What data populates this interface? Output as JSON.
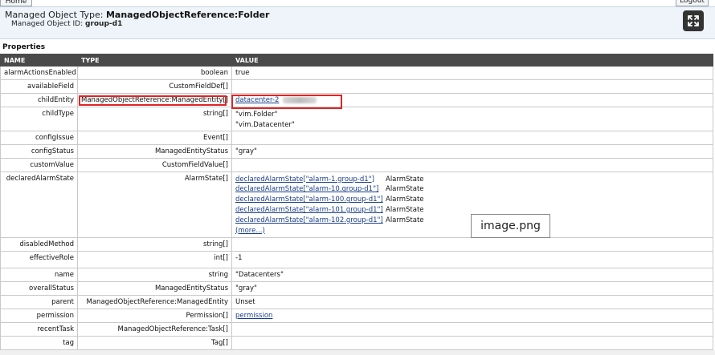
{
  "nav": {
    "home": "Home",
    "logout": "Logout"
  },
  "header": {
    "type_label": "Managed Object Type: ",
    "type_value": "ManagedObjectReference:Folder",
    "id_label": "Managed Object ID: ",
    "id_value": "group-d1"
  },
  "section_title": "Properties",
  "columns": {
    "name": "NAME",
    "type": "TYPE",
    "value": "VALUE"
  },
  "rows": [
    {
      "name": "alarmActionsEnabled",
      "type": "boolean",
      "value": "true"
    },
    {
      "name": "availableField",
      "type": "CustomFieldDef[]",
      "value": ""
    },
    {
      "name": "childEntity",
      "type": "ManagedObjectReference:ManagedEntity[]",
      "value_link": "datacenter-2"
    },
    {
      "name": "childType",
      "type": "string[]",
      "values": [
        "\"vim.Folder\"",
        "\"vim.Datacenter\""
      ]
    },
    {
      "name": "configIssue",
      "type": "Event[]",
      "value": ""
    },
    {
      "name": "configStatus",
      "type": "ManagedEntityStatus",
      "value": "\"gray\""
    },
    {
      "name": "customValue",
      "type": "CustomFieldValue[]",
      "value": ""
    },
    {
      "name": "declaredAlarmState",
      "type": "AlarmState[]",
      "alarms": [
        {
          "link": "declaredAlarmState[\"alarm-1.group-d1\"]",
          "type": "AlarmState"
        },
        {
          "link": "declaredAlarmState[\"alarm-10.group-d1\"]",
          "type": "AlarmState"
        },
        {
          "link": "declaredAlarmState[\"alarm-100.group-d1\"]",
          "type": "AlarmState"
        },
        {
          "link": "declaredAlarmState[\"alarm-101.group-d1\"]",
          "type": "AlarmState"
        },
        {
          "link": "declaredAlarmState[\"alarm-102.group-d1\"]",
          "type": "AlarmState"
        }
      ],
      "more": "(more...)"
    },
    {
      "name": "disabledMethod",
      "type": "string[]",
      "value": ""
    },
    {
      "name": "effectiveRole",
      "type": "int[]",
      "value": "-1"
    },
    {
      "name": "name",
      "type": "string",
      "value": "\"Datacenters\""
    },
    {
      "name": "overallStatus",
      "type": "ManagedEntityStatus",
      "value": "\"gray\""
    },
    {
      "name": "parent",
      "type": "ManagedObjectReference:ManagedEntity",
      "value": "Unset"
    },
    {
      "name": "permission",
      "type": "Permission[]",
      "value_link": "permission"
    },
    {
      "name": "recentTask",
      "type": "ManagedObjectReference:Task[]",
      "value": ""
    },
    {
      "name": "tag",
      "type": "Tag[]",
      "value": ""
    }
  ],
  "overlay_label": "image.png",
  "icons": {
    "fullscreen": "expand-arrows-icon"
  },
  "colors": {
    "header_bg": "#eef4fa",
    "table_header_bg": "#4a4a4a",
    "highlight": "#e02424",
    "link": "#1a3f8a"
  }
}
